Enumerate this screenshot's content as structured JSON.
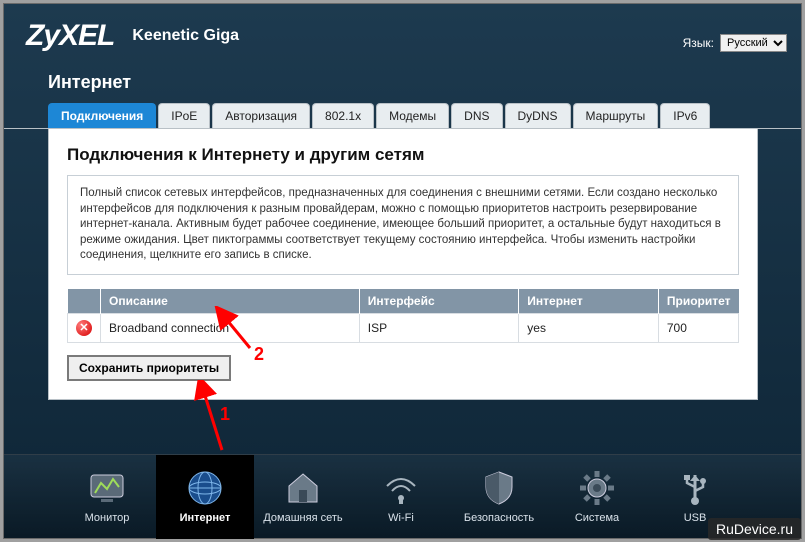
{
  "header": {
    "brand": "ZyXEL",
    "model": "Keenetic Giga",
    "lang_label": "Язык:",
    "lang_value": "Русский"
  },
  "page_title": "Интернет",
  "tabs": [
    {
      "label": "Подключения",
      "active": true
    },
    {
      "label": "IPoE"
    },
    {
      "label": "Авторизация"
    },
    {
      "label": "802.1x"
    },
    {
      "label": "Модемы"
    },
    {
      "label": "DNS"
    },
    {
      "label": "DyDNS"
    },
    {
      "label": "Маршруты"
    },
    {
      "label": "IPv6"
    }
  ],
  "panel": {
    "title": "Подключения к Интернету и другим сетям",
    "description": "Полный список сетевых интерфейсов, предназначенных для соединения с внешними сетями. Если создано несколько интерфейсов для подключения к разным провайдерам, можно с помощью приоритетов настроить резервирование интернет-канала. Активным будет рабочее соединение, имеющее больший приоритет, а остальные будут находиться в режиме ожидания. Цвет пиктограммы соответствует текущему состоянию интерфейса. Чтобы изменить настройки соединения, щелкните его запись в списке."
  },
  "table": {
    "cols": [
      "",
      "Описание",
      "Интерфейс",
      "Интернет",
      "Приоритет"
    ],
    "rows": [
      {
        "status": "error",
        "desc": "Broadband connection",
        "iface": "ISP",
        "internet": "yes",
        "prio": "700"
      }
    ]
  },
  "save_button": "Сохранить приоритеты",
  "annotations": {
    "a1": "1",
    "a2": "2"
  },
  "bottombar": [
    {
      "label": "Монитор",
      "icon": "monitor"
    },
    {
      "label": "Интернет",
      "icon": "globe",
      "active": true
    },
    {
      "label": "Домашняя сеть",
      "icon": "home"
    },
    {
      "label": "Wi-Fi",
      "icon": "wifi"
    },
    {
      "label": "Безопасность",
      "icon": "shield"
    },
    {
      "label": "Система",
      "icon": "gear"
    },
    {
      "label": "USB",
      "icon": "usb"
    }
  ],
  "watermark": "RuDevice.ru"
}
